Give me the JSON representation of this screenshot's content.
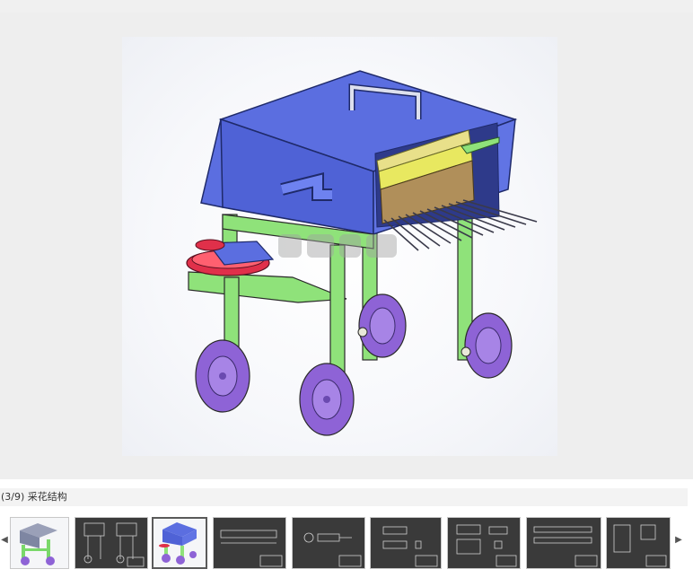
{
  "viewer": {
    "caption": "(3/9) 采花结构"
  },
  "thumbnails": [
    {
      "kind": "render-gray",
      "selected": false
    },
    {
      "kind": "drawing",
      "selected": false
    },
    {
      "kind": "render-color",
      "selected": true
    },
    {
      "kind": "drawing",
      "selected": false
    },
    {
      "kind": "drawing",
      "selected": false
    },
    {
      "kind": "drawing",
      "selected": false
    },
    {
      "kind": "drawing",
      "selected": false
    },
    {
      "kind": "drawing",
      "selected": false
    },
    {
      "kind": "drawing",
      "selected": false
    }
  ],
  "icons": {
    "prev": "chevron-left-icon",
    "next": "chevron-right-icon"
  },
  "colors": {
    "body": "#5b6ee0",
    "frame": "#8fe27a",
    "wheel": "#8e63d6",
    "tray": "#e0304a",
    "plate": "#b08f5a"
  }
}
